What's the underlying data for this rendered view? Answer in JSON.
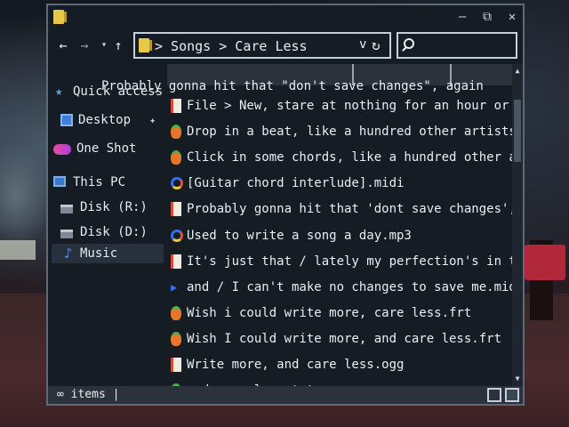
{
  "window": {
    "title_icon": "folder-icon",
    "minimize": "—",
    "maximize": "⧉",
    "close": "✕"
  },
  "nav": {
    "back": "←",
    "forward": "→",
    "recent": "▾",
    "up": "↑"
  },
  "address": {
    "path": "> Songs > Care Less",
    "chevron": "v",
    "refresh": "↻"
  },
  "search": {
    "placeholder": ""
  },
  "sidebar": {
    "items": [
      {
        "label": "Quick access",
        "icon": "star-icon"
      },
      {
        "label": "Desktop",
        "icon": "desktop-icon"
      },
      {
        "label": "One Shot",
        "icon": "cloud-icon"
      },
      {
        "label": "This PC",
        "icon": "pc-icon"
      },
      {
        "label": "Disk (R:)",
        "icon": "disk-icon"
      },
      {
        "label": "Disk (D:)",
        "icon": "disk-icon"
      },
      {
        "label": "Music",
        "icon": "music-icon"
      }
    ],
    "pin": "📌"
  },
  "overlay_text": "Probably gonna hit that \"don't save changes\", again",
  "files": [
    {
      "name": "File > New, stare at nothing for an hour or two",
      "icon": "document-icon"
    },
    {
      "name": "Drop in a beat, like a hundred other artists would",
      "icon": "fruity-icon"
    },
    {
      "name": "Click in some chords, like a hundred other artists would",
      "icon": "fruity-icon"
    },
    {
      "name": "[Guitar chord interlude].midi",
      "icon": "midi-icon"
    },
    {
      "name": "Probably gonna hit that 'dont save changes', again",
      "icon": "document-icon"
    },
    {
      "name": "Used to write a song a day.mp3",
      "icon": "midi-icon"
    },
    {
      "name": "It's just that / lately my perfection's in the way",
      "icon": "document-icon"
    },
    {
      "name": "and / I can't make no changes to save me.mid",
      "icon": "play-icon"
    },
    {
      "name": "Wish i could write more, care less.frt",
      "icon": "fruity-icon"
    },
    {
      "name": "Wish I could write more, and care less.frt",
      "icon": "fruity-icon"
    },
    {
      "name": "Write more, and care less.ogg",
      "icon": "document-icon"
    },
    {
      "name": "and care less.txt",
      "icon": "fruity-icon"
    }
  ],
  "status": {
    "text": "∞ items |"
  },
  "colors": {
    "window_bg": "#161c24",
    "border": "#5d6b78",
    "header": "#2b323b",
    "text": "#e8eef4"
  }
}
